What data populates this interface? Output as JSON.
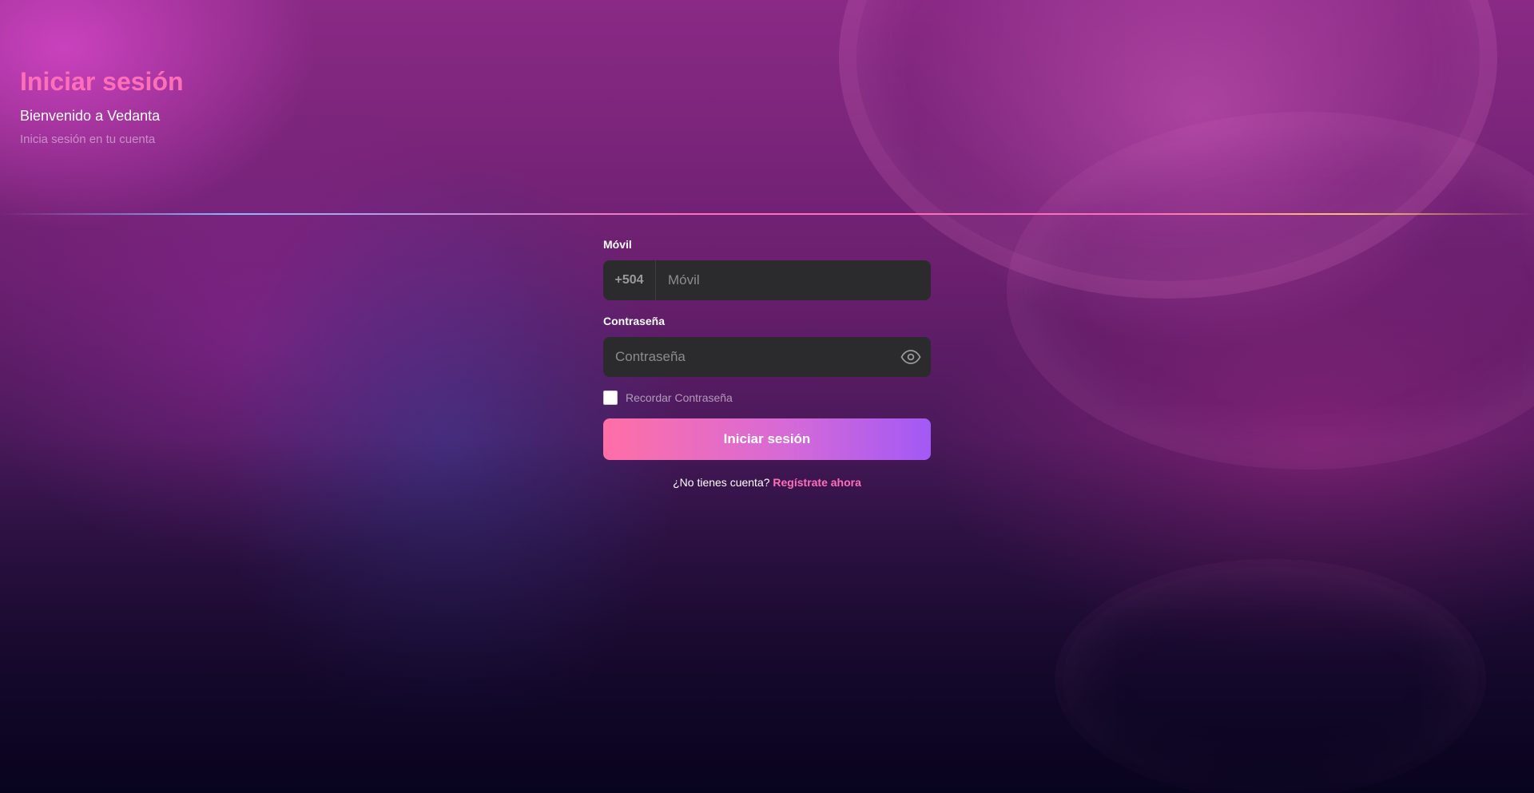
{
  "header": {
    "title": "Iniciar sesión",
    "welcome": "Bienvenido a Vedanta",
    "subtitle": "Inicia sesión en tu cuenta"
  },
  "form": {
    "mobile_label": "Móvil",
    "country_code": "+504",
    "mobile_placeholder": "Móvil",
    "mobile_value": "",
    "password_label": "Contraseña",
    "password_placeholder": "Contraseña",
    "password_value": "",
    "remember_label": "Recordar Contraseña",
    "remember_checked": false,
    "submit_label": "Iniciar sesión",
    "no_account_text": "¿No tienes cuenta?",
    "register_link": "Regístrate ahora"
  },
  "icons": {
    "password_toggle": "eye-icon"
  },
  "colors": {
    "accent_pink": "#ff6fb8",
    "button_gradient_start": "#ff6fa6",
    "button_gradient_end": "#a259f5",
    "input_bg": "#2b2b2d"
  }
}
